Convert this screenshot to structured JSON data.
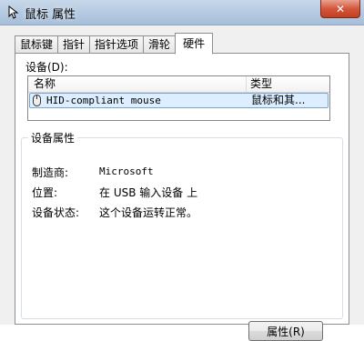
{
  "window": {
    "title": "鼠标 属性",
    "close_label": "✕"
  },
  "tabs": [
    {
      "label": "鼠标键",
      "active": false
    },
    {
      "label": "指针",
      "active": false
    },
    {
      "label": "指针选项",
      "active": false
    },
    {
      "label": "滑轮",
      "active": false
    },
    {
      "label": "硬件",
      "active": true
    }
  ],
  "devices": {
    "label": "设备(D):",
    "columns": [
      "名称",
      "类型"
    ],
    "rows": [
      {
        "name": "HID-compliant mouse",
        "type": "鼠标和其..."
      }
    ]
  },
  "properties": {
    "group_title": "设备属性",
    "items": [
      {
        "label": "制造商:",
        "value": "Microsoft"
      },
      {
        "label": "位置:",
        "value": "在 USB 输入设备 上"
      },
      {
        "label": "设备状态:",
        "value": "这个设备运转正常。"
      }
    ],
    "button_label": "属性(R)"
  }
}
